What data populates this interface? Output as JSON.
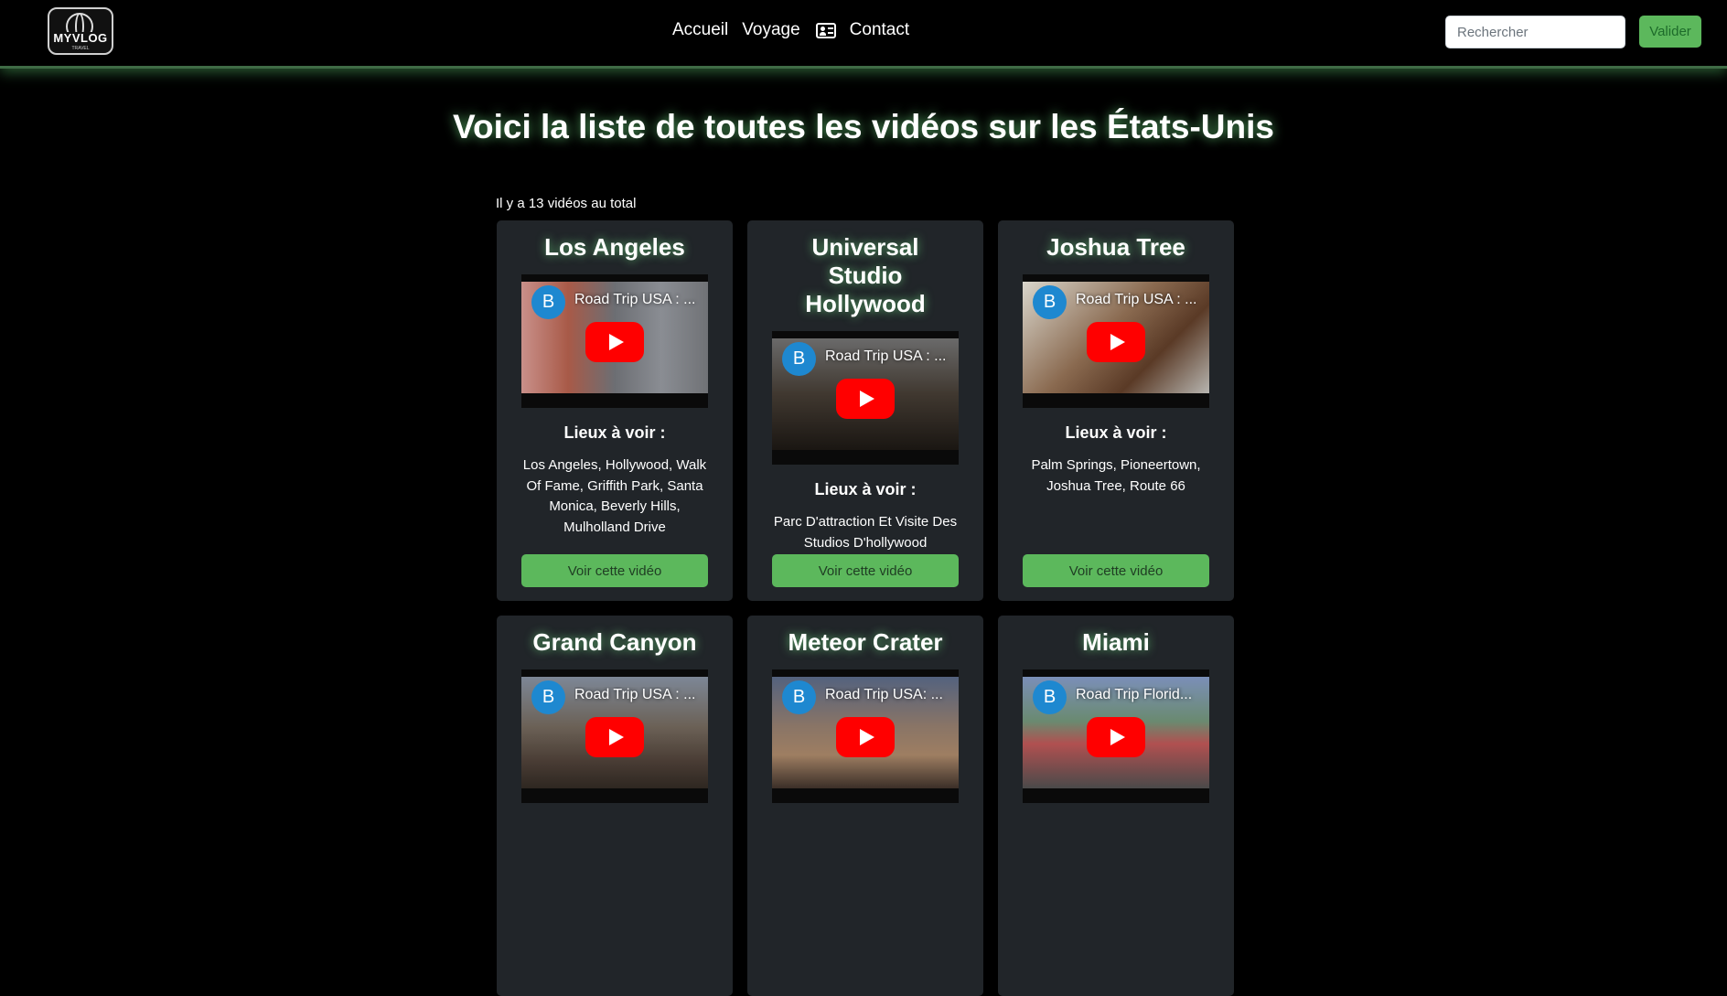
{
  "navbar": {
    "logo_text": "MYVLOG",
    "logo_subtext": "TRAVEL",
    "links": {
      "home": "Accueil",
      "travel": "Voyage",
      "contact": "Contact"
    },
    "search": {
      "placeholder": "Rechercher",
      "button_label": "Valider"
    }
  },
  "main": {
    "title": "Voici la liste de toutes les vidéos sur les États-Unis",
    "total_text": "Il y a 13 vidéos au total"
  },
  "cards": [
    {
      "title": "Los Angeles",
      "video": {
        "channel_initial": "B",
        "title": "Road Trip USA : ..."
      },
      "places_label": "Lieux à voir :",
      "places": "Los Angeles, Hollywood, Walk Of Fame, Griffith Park, Santa Monica, Beverly Hills, Mulholland Drive",
      "button_label": "Voir cette vidéo"
    },
    {
      "title": "Universal Studio Hollywood",
      "video": {
        "channel_initial": "B",
        "title": "Road Trip USA : ..."
      },
      "places_label": "Lieux à voir :",
      "places": "Parc D'attraction Et Visite Des Studios D'hollywood",
      "button_label": "Voir cette vidéo"
    },
    {
      "title": "Joshua Tree",
      "video": {
        "channel_initial": "B",
        "title": "Road Trip USA : ..."
      },
      "places_label": "Lieux à voir :",
      "places": "Palm Springs, Pioneertown, Joshua Tree, Route 66",
      "button_label": "Voir cette vidéo"
    },
    {
      "title": "Grand Canyon",
      "video": {
        "channel_initial": "B",
        "title": "Road Trip USA : ..."
      }
    },
    {
      "title": "Meteor Crater",
      "video": {
        "channel_initial": "B",
        "title": "Road Trip USA: ..."
      }
    },
    {
      "title": "Miami",
      "video": {
        "channel_initial": "B",
        "title": "Road Trip Florid..."
      }
    }
  ],
  "colors": {
    "background": "#000000",
    "card_background": "#212529",
    "accent_green": "#5cb85c",
    "youtube_red": "#ff0000",
    "channel_avatar": "#1e88d0"
  },
  "icons": {
    "contact": "contact-card-icon",
    "play": "play-icon",
    "logo": "globe-logo"
  }
}
